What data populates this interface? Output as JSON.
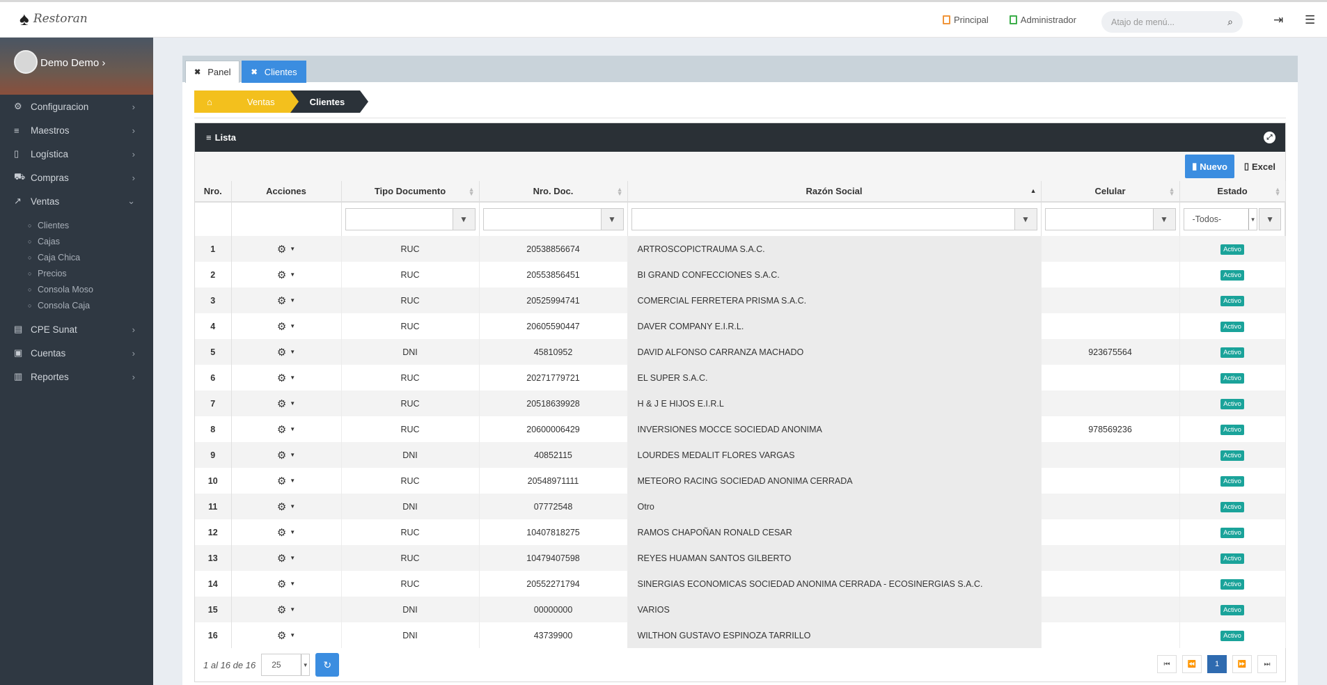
{
  "app": {
    "logo_text": "Restoran"
  },
  "header": {
    "links": [
      {
        "label": "Principal",
        "color": "#f0953a"
      },
      {
        "label": "Administrador",
        "color": "#3cae4a"
      }
    ],
    "search_placeholder": "Atajo de menú..."
  },
  "sidebar": {
    "user_name": "Demo Demo",
    "items": [
      {
        "label": "Configuracion",
        "icon": "gears-icon"
      },
      {
        "label": "Maestros",
        "icon": "list-icon"
      },
      {
        "label": "Logística",
        "icon": "building-icon"
      },
      {
        "label": "Compras",
        "icon": "cart-icon"
      },
      {
        "label": "Ventas",
        "icon": "chart-icon"
      }
    ],
    "ventas_sub": [
      "Clientes",
      "Cajas",
      "Caja Chica",
      "Precios",
      "Consola Moso",
      "Consola Caja"
    ],
    "items_after": [
      {
        "label": "CPE Sunat",
        "icon": "file-icon"
      },
      {
        "label": "Cuentas",
        "icon": "card-icon"
      },
      {
        "label": "Reportes",
        "icon": "book-icon"
      }
    ]
  },
  "tabs": [
    "Panel",
    "Clientes"
  ],
  "breadcrumb": {
    "level1": "Ventas",
    "level2": "Clientes"
  },
  "panel": {
    "title": "Lista",
    "new_label": "Nuevo",
    "excel_label": "Excel"
  },
  "table": {
    "headers": [
      "Nro.",
      "Acciones",
      "Tipo Documento",
      "Nro. Doc.",
      "Razón Social",
      "Celular",
      "Estado"
    ],
    "estado_filter": "-Todos-",
    "rows": [
      {
        "n": "1",
        "tipo": "RUC",
        "doc": "20538856674",
        "razon": "ARTROSCOPICTRAUMA S.A.C.",
        "cel": "",
        "estado": "Activo"
      },
      {
        "n": "2",
        "tipo": "RUC",
        "doc": "20553856451",
        "razon": "BI GRAND CONFECCIONES S.A.C.",
        "cel": "",
        "estado": "Activo"
      },
      {
        "n": "3",
        "tipo": "RUC",
        "doc": "20525994741",
        "razon": "COMERCIAL FERRETERA PRISMA S.A.C.",
        "cel": "",
        "estado": "Activo"
      },
      {
        "n": "4",
        "tipo": "RUC",
        "doc": "20605590447",
        "razon": "DAVER COMPANY E.I.R.L.",
        "cel": "",
        "estado": "Activo"
      },
      {
        "n": "5",
        "tipo": "DNI",
        "doc": "45810952",
        "razon": "DAVID ALFONSO CARRANZA MACHADO",
        "cel": "923675564",
        "estado": "Activo"
      },
      {
        "n": "6",
        "tipo": "RUC",
        "doc": "20271779721",
        "razon": "EL SUPER S.A.C.",
        "cel": "",
        "estado": "Activo"
      },
      {
        "n": "7",
        "tipo": "RUC",
        "doc": "20518639928",
        "razon": "H & J E HIJOS E.I.R.L",
        "cel": "",
        "estado": "Activo"
      },
      {
        "n": "8",
        "tipo": "RUC",
        "doc": "20600006429",
        "razon": "INVERSIONES MOCCE SOCIEDAD ANONIMA",
        "cel": "978569236",
        "estado": "Activo"
      },
      {
        "n": "9",
        "tipo": "DNI",
        "doc": "40852115",
        "razon": "LOURDES MEDALIT FLORES VARGAS",
        "cel": "",
        "estado": "Activo"
      },
      {
        "n": "10",
        "tipo": "RUC",
        "doc": "20548971111",
        "razon": "METEORO RACING SOCIEDAD ANONIMA CERRADA",
        "cel": "",
        "estado": "Activo"
      },
      {
        "n": "11",
        "tipo": "DNI",
        "doc": "07772548",
        "razon": "Otro",
        "cel": "",
        "estado": "Activo"
      },
      {
        "n": "12",
        "tipo": "RUC",
        "doc": "10407818275",
        "razon": "RAMOS CHAPOÑAN RONALD CESAR",
        "cel": "",
        "estado": "Activo"
      },
      {
        "n": "13",
        "tipo": "RUC",
        "doc": "10479407598",
        "razon": "REYES HUAMAN SANTOS GILBERTO",
        "cel": "",
        "estado": "Activo"
      },
      {
        "n": "14",
        "tipo": "RUC",
        "doc": "20552271794",
        "razon": "SINERGIAS ECONOMICAS SOCIEDAD ANONIMA CERRADA - ECOSINERGIAS S.A.C.",
        "cel": "",
        "estado": "Activo"
      },
      {
        "n": "15",
        "tipo": "DNI",
        "doc": "00000000",
        "razon": "VARIOS",
        "cel": "",
        "estado": "Activo"
      },
      {
        "n": "16",
        "tipo": "DNI",
        "doc": "43739900",
        "razon": "WILTHON GUSTAVO ESPINOZA TARRILLO",
        "cel": "",
        "estado": "Activo"
      }
    ]
  },
  "pagination": {
    "info": "1 al 16 de 16",
    "page_size": "25",
    "current_page": "1"
  }
}
